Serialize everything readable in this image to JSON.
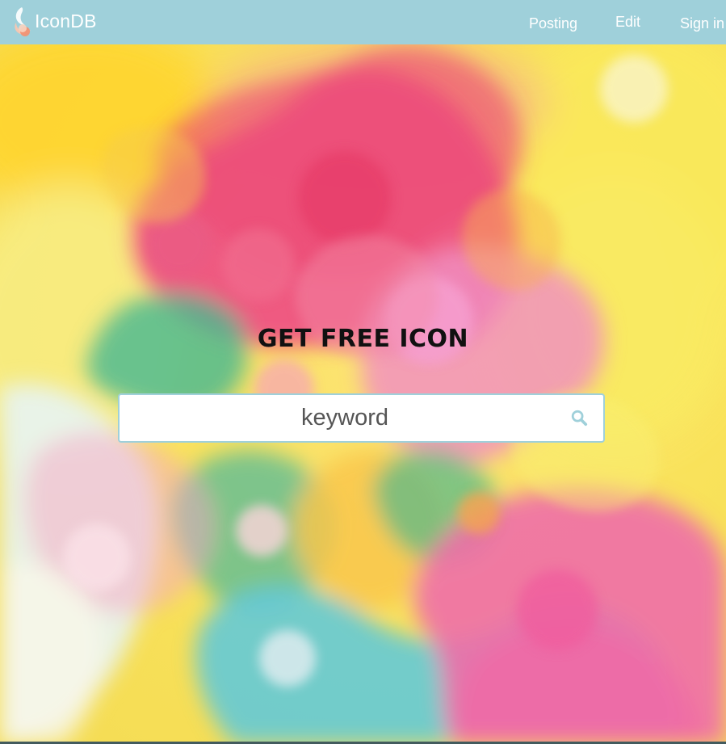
{
  "navbar": {
    "brand": "IconDB",
    "links": [
      {
        "label": "Posting"
      },
      {
        "label": "Edit"
      },
      {
        "label": "Sign in"
      }
    ]
  },
  "hero": {
    "title": "GET FREE ICON",
    "search": {
      "placeholder": "keyword",
      "value": "",
      "button_icon": "search-icon"
    }
  },
  "colors": {
    "navbar": "#9fd0da",
    "accent": "#9fd0da",
    "title": "#111111",
    "search_background": "#ffffff"
  }
}
